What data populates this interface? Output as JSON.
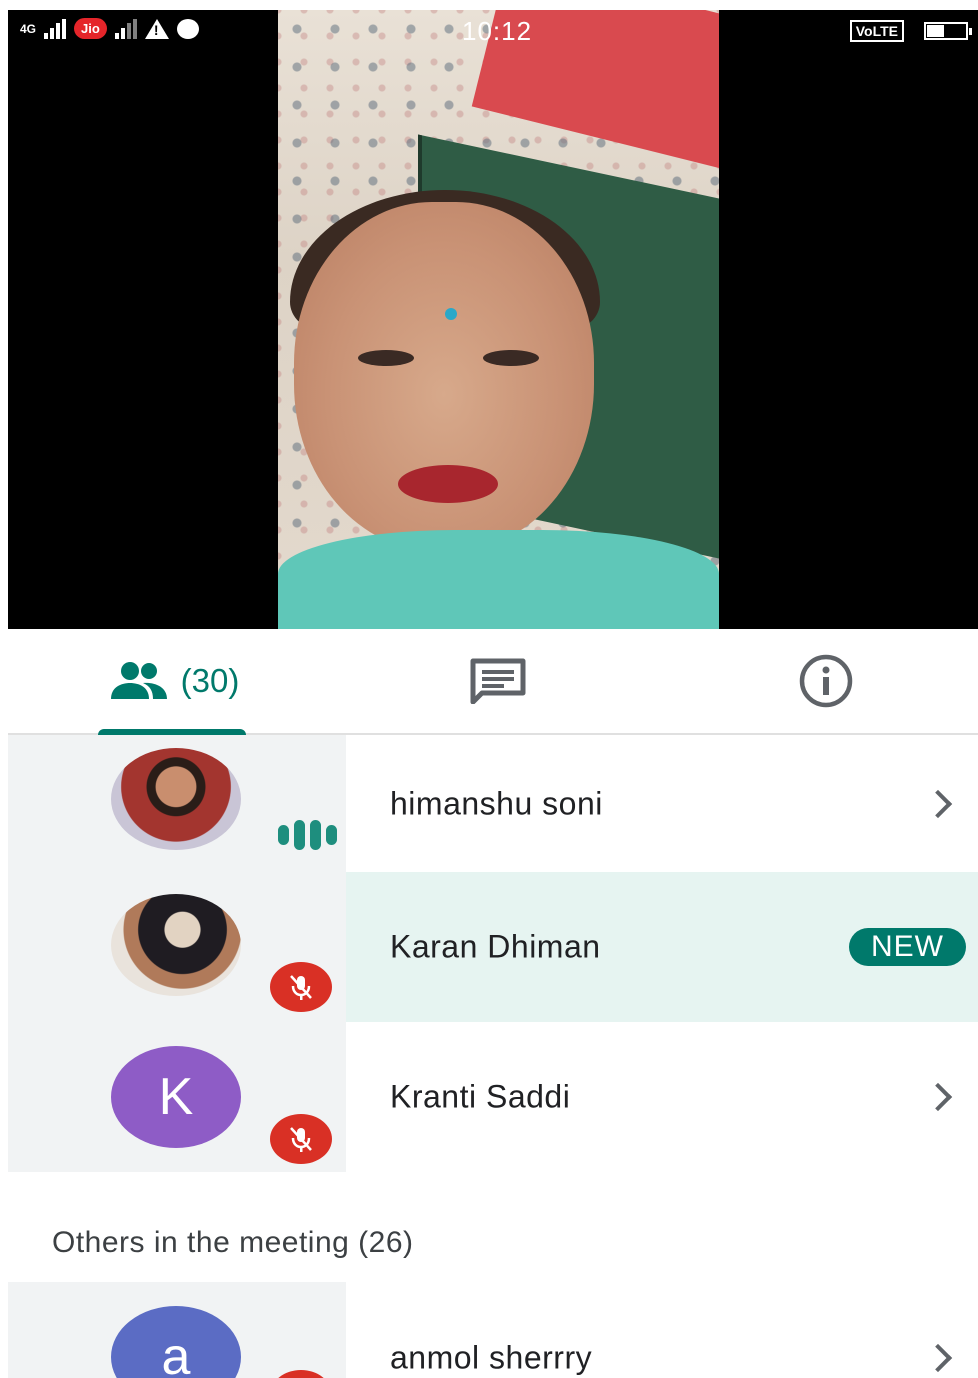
{
  "status_bar": {
    "network_type": "4G",
    "carrier_badge": "Jio",
    "time": "10:12",
    "volte_label": "VoLTE",
    "battery_level": 0.45
  },
  "tabs": {
    "people_count": "(30)",
    "active": "people",
    "chat_icon": "chat-icon",
    "info_icon": "info-icon"
  },
  "participants": [
    {
      "name": "himanshu soni",
      "status": "speaking"
    },
    {
      "name": "Karan Dhiman",
      "status": "muted",
      "badge": "NEW"
    },
    {
      "name": "Kranti Saddi",
      "status": "muted",
      "initial": "K"
    }
  ],
  "others": {
    "title": "Others in the meeting (26)",
    "items": [
      {
        "name": "anmol sherrry",
        "initial": "a"
      }
    ]
  },
  "colors": {
    "accent": "#00796b",
    "muted_badge": "#d93025",
    "new_row_bg": "#e6f4f1",
    "kranti_avatar": "#8e5cc6",
    "anmol_avatar": "#5b6cc4"
  }
}
